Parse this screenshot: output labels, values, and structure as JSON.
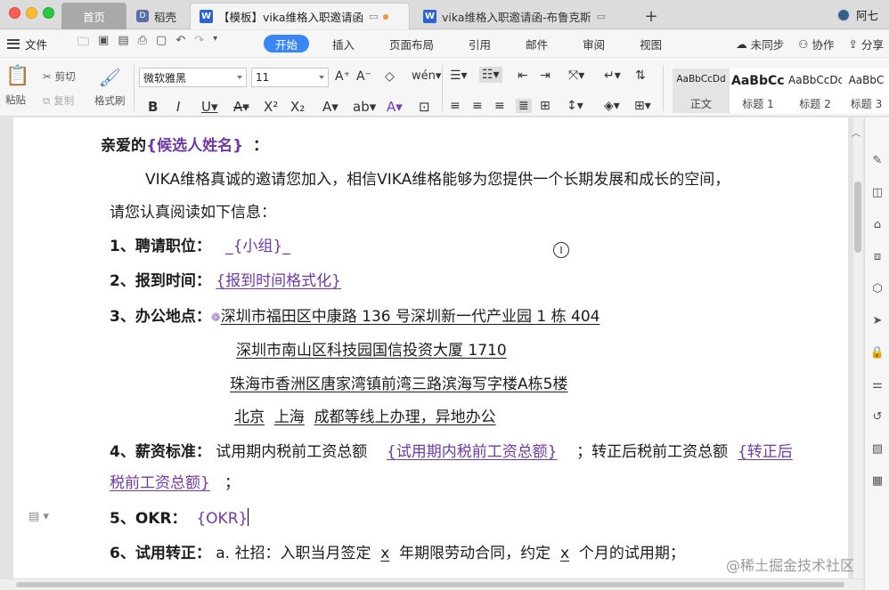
{
  "titlebar": {
    "tabs": [
      {
        "label": "首页"
      },
      {
        "label": "稻壳"
      },
      {
        "label": "【模板】vika维格入职邀请函"
      },
      {
        "label": "vika维格入职邀请函-布鲁克斯"
      }
    ],
    "new_tab": "+",
    "user": "阿七"
  },
  "menubar": {
    "file": "文件",
    "tabs": [
      "开始",
      "插入",
      "页面布局",
      "引用",
      "邮件",
      "审阅",
      "视图"
    ],
    "active_tab": "开始",
    "sync": "未同步",
    "collab": "协作",
    "share": "分享"
  },
  "ribbon": {
    "cut": "剪切",
    "copy": "复制",
    "paste": "粘贴",
    "format_painter": "格式刷",
    "font_name": "微软雅黑",
    "font_size": "11",
    "styles": [
      {
        "sample": "AaBbCcDd",
        "label": "正文"
      },
      {
        "sample": "AaBbCcI",
        "label": "标题 1"
      },
      {
        "sample": "AaBbCcDc",
        "label": "标题 2"
      },
      {
        "sample": "AaBbC",
        "label": "标题 3"
      }
    ]
  },
  "document": {
    "greeting_prefix": "亲爱的",
    "greeting_field": "{候选人姓名}",
    "greeting_suffix": "：",
    "intro_1": "VIKA维格真诚的邀请您加入，相信VIKA维格能够为您提供一个长期发展和成长的空间，",
    "intro_2": "请您认真阅读如下信息：",
    "item1_label": "1、聘请职位：",
    "item1_field": "_{小组}_",
    "item2_label": "2、报到时间：",
    "item2_field": "{报到时间格式化}",
    "item3_label": "3、办公地点：",
    "address_1": "深圳市福田区中康路 136 号深圳新一代产业园 1 栋 404",
    "address_2": "深圳市南山区科技园国信投资大厦 1710",
    "address_3": "珠海市香洲区唐家湾镇前湾三路滨海写字楼A栋5楼",
    "address_4a": "北京",
    "address_4b": "上海",
    "address_4c": "成都等线上办理，异地办公",
    "item4_label": "4、薪资标准：",
    "item4_text1": "试用期内税前工资总额",
    "item4_field1": "{试用期内税前工资总额}",
    "item4_text2": "；转正后税前工资总额",
    "item4_field2a": "{转正后",
    "item4_field2b": "税前工资总额}",
    "item4_end": "；",
    "item5_label": "5、OKR：",
    "item5_field": "{OKR}",
    "item6_label": "6、试用转正：",
    "item6_text1": "a.  社招：入职当月签定",
    "item6_x1": "x",
    "item6_text2": "年期限劳动合同，约定",
    "item6_x2": "x",
    "item6_text3": "个月的试用期；"
  },
  "watermark": "@稀土掘金技术社区"
}
